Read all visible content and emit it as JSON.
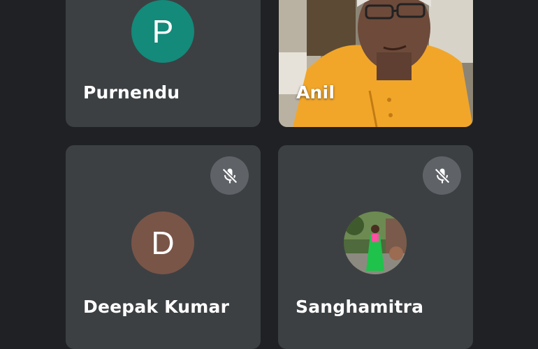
{
  "participants": [
    {
      "name": "Purnendu",
      "initial": "P",
      "avatar_color": "#138a7a",
      "muted": false,
      "video": false
    },
    {
      "name": "Anil",
      "initial": "",
      "muted": false,
      "video": true
    },
    {
      "name": "Deepak Kumar",
      "initial": "D",
      "avatar_color": "#795548",
      "muted": true,
      "video": false
    },
    {
      "name": "Sanghamitra",
      "initial": "",
      "muted": true,
      "video": false,
      "avatar_photo": true
    }
  ],
  "icons": {
    "muted": "mic-off-icon"
  },
  "colors": {
    "background": "#202124",
    "tile": "#3c4043",
    "mute_badge": "#5f6368"
  }
}
